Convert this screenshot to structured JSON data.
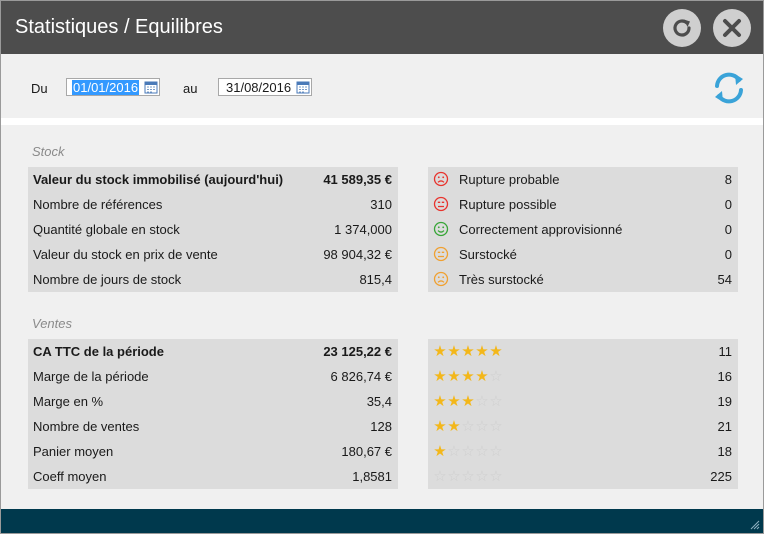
{
  "window": {
    "title": "Statistiques / Equilibres"
  },
  "filters": {
    "from_label": "Du",
    "from_value": "01/01/2016",
    "to_label": "au",
    "to_value": "31/08/2016"
  },
  "stock": {
    "section_title": "Stock",
    "rows": [
      {
        "label": "Valeur du stock immobilisé (aujourd'hui)",
        "value": "41 589,35 €",
        "bold": true
      },
      {
        "label": "Nombre de références",
        "value": "310"
      },
      {
        "label": "Quantité globale en stock",
        "value": "1 374,000"
      },
      {
        "label": "Valeur du stock en prix de vente",
        "value": "98 904,32 €"
      },
      {
        "label": "Nombre de jours de stock",
        "value": "815,4"
      }
    ],
    "status_rows": [
      {
        "label": "Rupture probable",
        "value": "8",
        "icon": "sad-face-red-icon",
        "color": "#e8332d"
      },
      {
        "label": "Rupture possible",
        "value": "0",
        "icon": "neutral-face-red-icon",
        "color": "#e8332d"
      },
      {
        "label": "Correctement approvisionné",
        "value": "0",
        "icon": "happy-face-green-icon",
        "color": "#37a537"
      },
      {
        "label": "Surstocké",
        "value": "0",
        "icon": "neutral-face-orange-icon",
        "color": "#f0a030"
      },
      {
        "label": "Très surstocké",
        "value": "54",
        "icon": "sad-face-orange-icon",
        "color": "#f0a030"
      }
    ]
  },
  "ventes": {
    "section_title": "Ventes",
    "rows": [
      {
        "label": "CA TTC de la période",
        "value": "23 125,22 €",
        "bold": true
      },
      {
        "label": "Marge de la période",
        "value": "6 826,74 €"
      },
      {
        "label": "Marge en %",
        "value": "35,4"
      },
      {
        "label": "Nombre de ventes",
        "value": "128"
      },
      {
        "label": "Panier moyen",
        "value": "180,67 €"
      },
      {
        "label": "Coeff moyen",
        "value": "1,8581"
      }
    ],
    "rating_rows": [
      {
        "stars": 5,
        "value": "11"
      },
      {
        "stars": 4,
        "value": "16"
      },
      {
        "stars": 3,
        "value": "19"
      },
      {
        "stars": 2,
        "value": "21"
      },
      {
        "stars": 1,
        "value": "18"
      },
      {
        "stars": 0,
        "value": "225"
      }
    ]
  },
  "colors": {
    "titlebar": "#4d4d4d",
    "footer": "#00394d",
    "star": "#f3b71a",
    "accent_refresh": "#3aa3d8"
  }
}
